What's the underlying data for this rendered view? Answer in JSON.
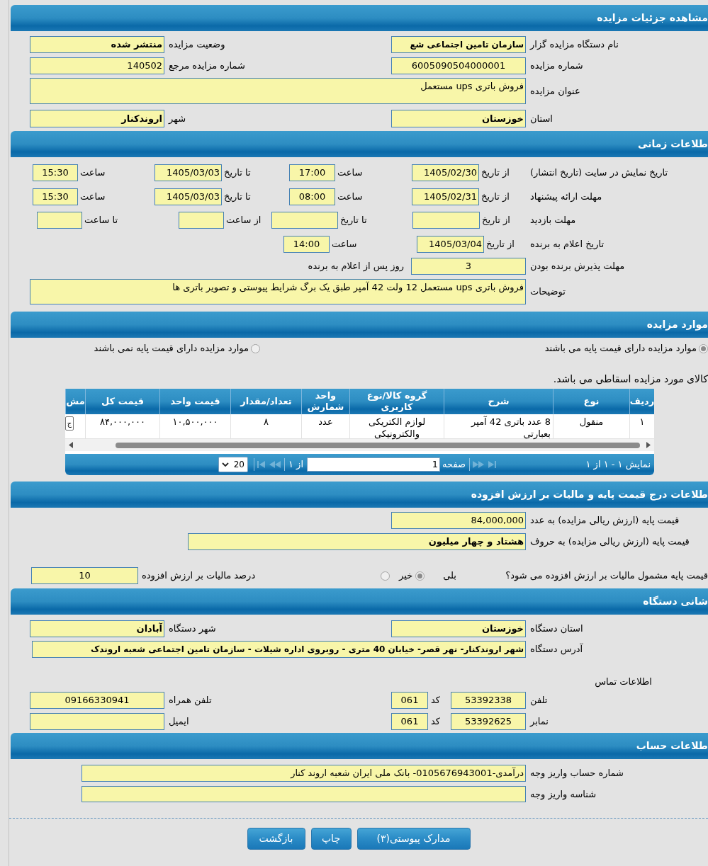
{
  "details": {
    "header": "مشاهده جزئیات مزایده",
    "organizer": {
      "label": "نام دستگاه مزایده گزار",
      "value": "سازمان تامین اجتماعی شع"
    },
    "status": {
      "label": "وضعیت مزایده",
      "value": "منتشر شده"
    },
    "auction_number": {
      "label": "شماره مزایده",
      "value": "6005090504000001"
    },
    "reference_number": {
      "label": "شماره مزایده مرجع",
      "value": "140502"
    },
    "title": {
      "label": "عنوان مزایده",
      "value": "فروش باتری ups مستعمل"
    },
    "province": {
      "label": "استان",
      "value": "خوزستان"
    },
    "city": {
      "label": "شهر",
      "value": "اروندکنار"
    }
  },
  "schedule": {
    "header": "طلاعات زمانی",
    "rows": [
      {
        "label": "تاریخ نمایش در سایت (تاریخ انتشار)",
        "fields": [
          {
            "label": "از تاریخ",
            "value": "1405/02/30"
          },
          {
            "label": "ساعت",
            "value": "17:00"
          },
          {
            "label": "تا تاریخ",
            "value": "1405/03/03"
          },
          {
            "label": "ساعت",
            "value": "15:30"
          }
        ]
      },
      {
        "label": "مهلت ارائه پیشنهاد",
        "fields": [
          {
            "label": "از تاریخ",
            "value": "1405/02/31"
          },
          {
            "label": "ساعت",
            "value": "08:00"
          },
          {
            "label": "تا تاریخ",
            "value": "1405/03/03"
          },
          {
            "label": "ساعت",
            "value": "15:30"
          }
        ]
      },
      {
        "label": "مهلت بازدید",
        "fields": [
          {
            "label": "از تاریخ"
          },
          {
            "label": "تا تاریخ"
          },
          {
            "label": "از ساعت"
          },
          {
            "label": "تا ساعت"
          }
        ]
      },
      {
        "label": "تاریخ اعلام به برنده",
        "fields": [
          {
            "label": "از تاریخ",
            "value": "1405/03/04"
          },
          {
            "label": "ساعت",
            "value": "14:00"
          }
        ]
      }
    ],
    "acceptance": {
      "label": "مهلت پذیرش برنده بودن",
      "value": "3",
      "suffix": "روز پس از اعلام به برنده"
    },
    "description": {
      "label": "توضیحات",
      "value": "فروش باتری ups مستعمل 12 ولت 42 آمپر طبق یک برگ شرایط پیوستی و تصویر باتری ها"
    }
  },
  "items": {
    "header": "موارد مزایده",
    "price_options": [
      {
        "label": "موارد مزایده دارای قیمت پایه می باشند",
        "selected": true
      },
      {
        "label": "موارد مزایده دارای قیمت پایه نمی باشند",
        "selected": false
      }
    ],
    "note": "کالای مورد مزایده اسقاطی می باشد.",
    "table": {
      "columns": [
        "ردیف",
        "نوع",
        "شرح",
        "گروه کالا/نوع کاربری",
        "واحد شمارش",
        "تعداد/مقدار",
        "قیمت واحد",
        "قیمت کل",
        "مش"
      ],
      "rows": [
        [
          "۱",
          "منقول",
          "8 عدد باتری 42 آمپر بعبارتی",
          "لوازم الکتریکی والکترونیکی",
          "عدد",
          "۸",
          "۱۰,۵۰۰,۰۰۰",
          "۸۴,۰۰۰,۰۰۰",
          "ج"
        ]
      ]
    },
    "pager": {
      "summary": "نمایش ۱ - ۱ از ۱",
      "nav": [
        {
          "kind": "first",
          "disabled": true
        },
        {
          "kind": "previous",
          "disabled": true
        },
        {
          "kind": "next",
          "disabled": true
        },
        {
          "kind": "last",
          "disabled": true
        }
      ],
      "page_label": "صفحه",
      "page": "1",
      "page_count": "از ۱",
      "page_size": "20"
    }
  },
  "pricing": {
    "header": "طلاعات درج قیمت پایه و مالیات بر ارزش افزوده",
    "amount_number": {
      "label": "قیمت پایه (ارزش ریالی مزایده) به عدد",
      "value": "84,000,000"
    },
    "amount_words": {
      "label": "قیمت پایه (ارزش ریالی مزایده) به حروف",
      "value": "هشتاد و چهار میلیون"
    },
    "vat_question": "قیمت پایه مشمول مالیات بر ارزش افزوده می شود؟",
    "vat_options": [
      {
        "label": "بلی",
        "selected": true
      },
      {
        "label": "خیر",
        "selected": false
      }
    ],
    "vat_percent": {
      "label": "درصد مالیات بر ارزش افزوده",
      "value": "10"
    }
  },
  "device_address": {
    "header": "شانی دستگاه",
    "province": {
      "label": "استان دستگاه",
      "value": "خوزستان"
    },
    "city": {
      "label": "شهر دستگاه",
      "value": "آبادان"
    },
    "address": {
      "label": "آدرس دستگاه",
      "value": "شهر اروندکنار- نهر قصر- خیابان 40 متری - روبروی اداره شیلات - سازمان تامین اجتماعی شعبه اروندک"
    },
    "contact_title": "اطلاعات تماس",
    "phone": {
      "label": "تلفن",
      "value": "53392338",
      "code_label": "کد",
      "code": "061"
    },
    "mobile": {
      "label": "تلفن همراه",
      "value": "09166330941"
    },
    "fax": {
      "label": "نمابر",
      "value": "53392625",
      "code_label": "کد",
      "code": "061"
    },
    "email": {
      "label": "ایمیل"
    }
  },
  "account": {
    "header": "طلاعات حساب",
    "account_number": {
      "label": "شماره حساب واریز وجه",
      "value": "درآمدی-0105676943001- بانک ملی ایران شعبه اروند کنار"
    },
    "payment_id": {
      "label": "شناسه واریز وجه"
    }
  },
  "buttons": [
    "مدارک پیوستی(۳)",
    "چاپ",
    "بازگشت"
  ]
}
